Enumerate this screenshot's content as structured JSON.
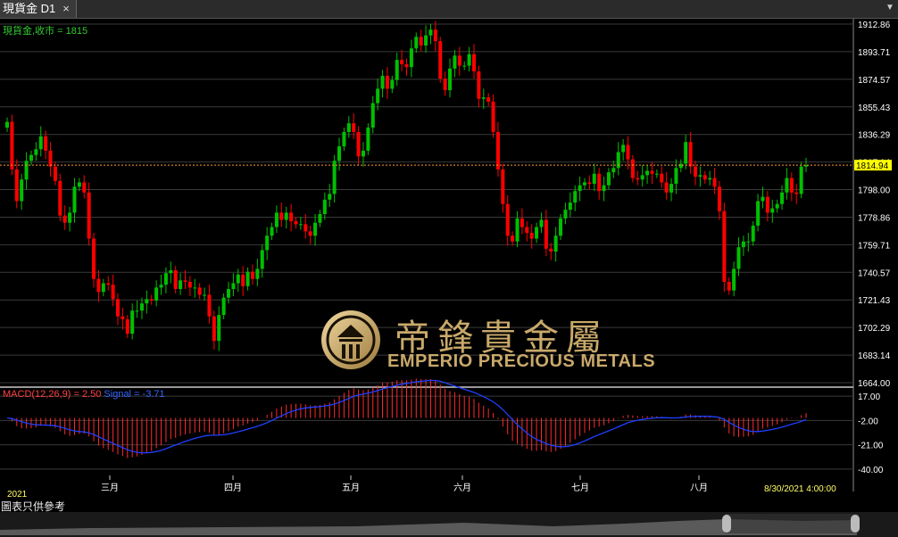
{
  "tab": {
    "title": "現貨金 D1",
    "close_glyph": "×",
    "menu_glyph": "▼"
  },
  "footer": {
    "disclaimer": "圖表只供參考"
  },
  "logo": {
    "cn": "帝鋒貴金屬",
    "en": "EMPERIO PRECIOUS METALS"
  },
  "colors": {
    "up": "#00c000",
    "down": "#ff0000",
    "grid": "#3a3a3a",
    "axis_text": "#ffffff",
    "price_box": "#ffff00",
    "macd_hist": "#ff2a2a",
    "signal": "#1f3fff",
    "legend_price": "#33cc33",
    "legend_macd": "#ff4040",
    "legend_signal": "#3366ff"
  },
  "chart_data": {
    "type": "candlestick",
    "legend": "現貨金,收市 = 1815",
    "y_axis_ticks": [
      "1912.86",
      "1893.71",
      "1874.57",
      "1855.43",
      "1836.29",
      "1817.14",
      "1798.00",
      "1778.86",
      "1759.71",
      "1740.57",
      "1721.43",
      "1702.29",
      "1683.14",
      "1664.00"
    ],
    "ylim": [
      1664.0,
      1912.86
    ],
    "current_price": "1814.94",
    "year_label": "2021",
    "x_axis_labels": [
      "三月",
      "四月",
      "五月",
      "六月",
      "七月",
      "八月"
    ],
    "last_time": "8/30/2021 4:00:00",
    "closes": [
      1845,
      1812,
      1790,
      1805,
      1818,
      1822,
      1826,
      1835,
      1825,
      1814,
      1804,
      1780,
      1775,
      1782,
      1800,
      1803,
      1796,
      1764,
      1736,
      1727,
      1733,
      1732,
      1722,
      1710,
      1708,
      1698,
      1714,
      1714,
      1719,
      1722,
      1721,
      1730,
      1732,
      1740,
      1742,
      1729,
      1735,
      1734,
      1730,
      1730,
      1725,
      1725,
      1710,
      1693,
      1711,
      1723,
      1729,
      1733,
      1739,
      1731,
      1741,
      1736,
      1743,
      1756,
      1766,
      1772,
      1782,
      1777,
      1782,
      1776,
      1774,
      1774,
      1769,
      1766,
      1775,
      1781,
      1791,
      1795,
      1818,
      1828,
      1838,
      1844,
      1838,
      1821,
      1825,
      1841,
      1858,
      1868,
      1877,
      1868,
      1874,
      1888,
      1885,
      1883,
      1896,
      1904,
      1898,
      1905,
      1909,
      1901,
      1875,
      1867,
      1882,
      1891,
      1884,
      1884,
      1892,
      1880,
      1861,
      1862,
      1859,
      1838,
      1812,
      1788,
      1766,
      1762,
      1778,
      1772,
      1768,
      1764,
      1772,
      1777,
      1757,
      1755,
      1766,
      1778,
      1784,
      1789,
      1797,
      1801,
      1803,
      1802,
      1809,
      1797,
      1801,
      1810,
      1813,
      1824,
      1829,
      1819,
      1806,
      1805,
      1808,
      1811,
      1809,
      1809,
      1803,
      1796,
      1802,
      1813,
      1816,
      1831,
      1814,
      1807,
      1808,
      1805,
      1806,
      1800,
      1783,
      1734,
      1728,
      1743,
      1758,
      1762,
      1762,
      1773,
      1790,
      1793,
      1782,
      1785,
      1788,
      1796,
      1806,
      1796,
      1795,
      1814,
      1815
    ],
    "macd": {
      "label": "MACD(12,26,9) = 2.50",
      "signal_label": "Signal = -3.71",
      "ticks": [
        "17.00",
        "-2.00",
        "-21.00",
        "-40.00"
      ],
      "ylim": [
        -45,
        22
      ]
    }
  }
}
